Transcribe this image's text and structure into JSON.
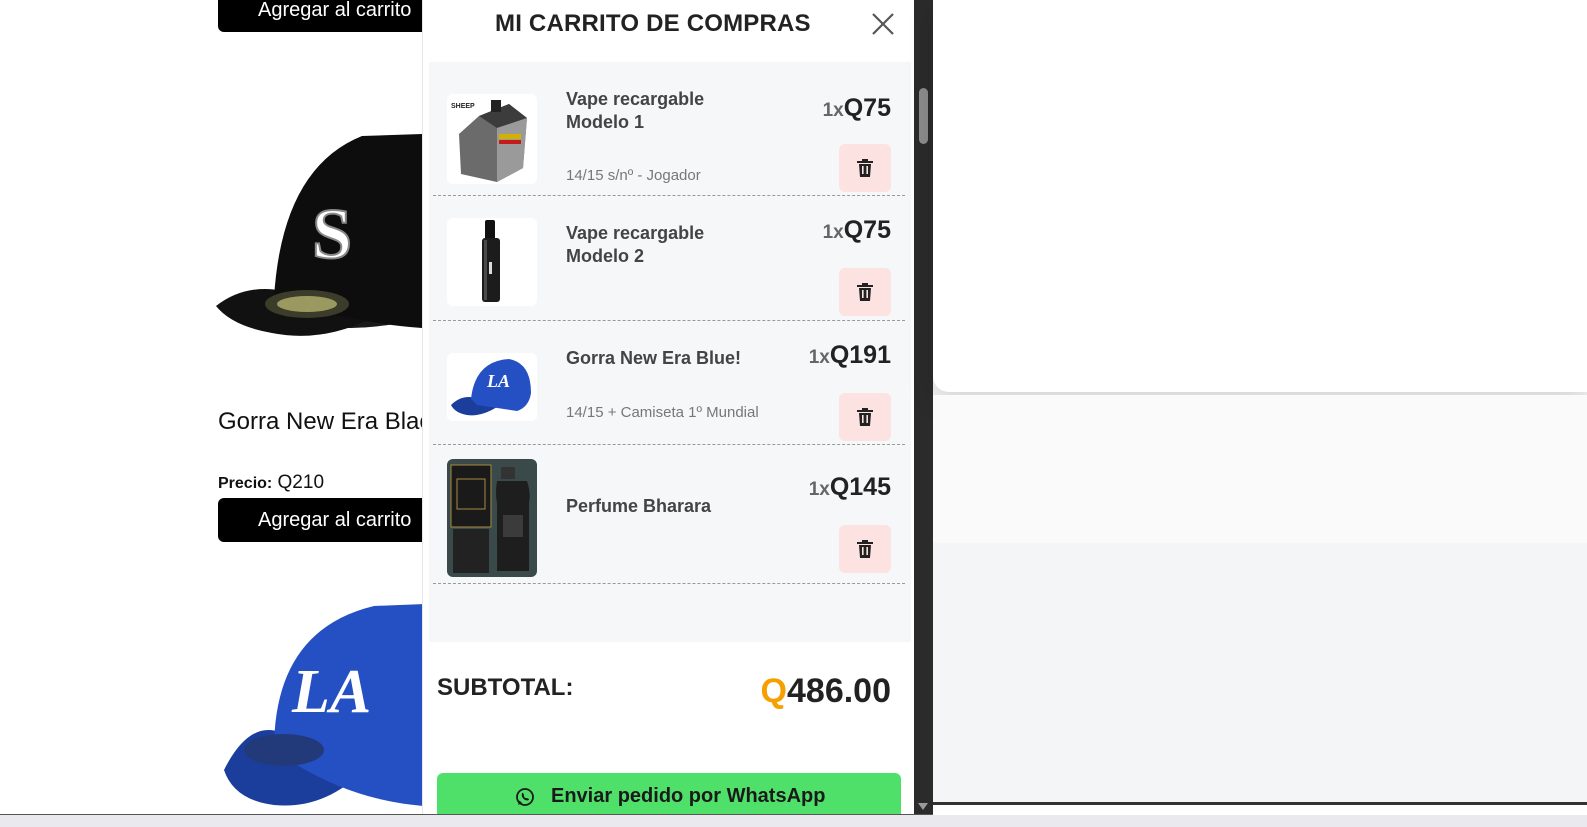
{
  "store": {
    "add_to_cart_label": "Agregar al carrito",
    "product_name": "Gorra New Era Black",
    "price_label": "Precio:",
    "price_value": "Q210"
  },
  "cart": {
    "title": "MI CARRITO DE COMPRAS",
    "items": [
      {
        "name": "Vape recargable Modelo 1",
        "variant": "14/15 s/nº - Jogador",
        "qty": "1x",
        "price": "Q75"
      },
      {
        "name": "Vape recargable Modelo 2",
        "variant": "",
        "qty": "1x",
        "price": "Q75"
      },
      {
        "name": "Gorra New Era Blue!",
        "variant": "14/15 + Camiseta 1º Mundial",
        "qty": "1x",
        "price": "Q191"
      },
      {
        "name": "Perfume Bharara",
        "variant": "",
        "qty": "1x",
        "price": "Q145"
      }
    ],
    "subtotal_label": "SUBTOTAL:",
    "subtotal_currency": "Q",
    "subtotal_amount": "486.00",
    "whatsapp_label": "Enviar pedido por WhatsApp"
  },
  "icons": {
    "close": "close-icon",
    "trash": "trash-icon",
    "whatsapp": "whatsapp-icon"
  },
  "colors": {
    "primary_button": "#000000",
    "whatsapp_green": "#4fe06a",
    "trash_bg": "#fde2e2",
    "currency_accent": "#f5a000"
  }
}
